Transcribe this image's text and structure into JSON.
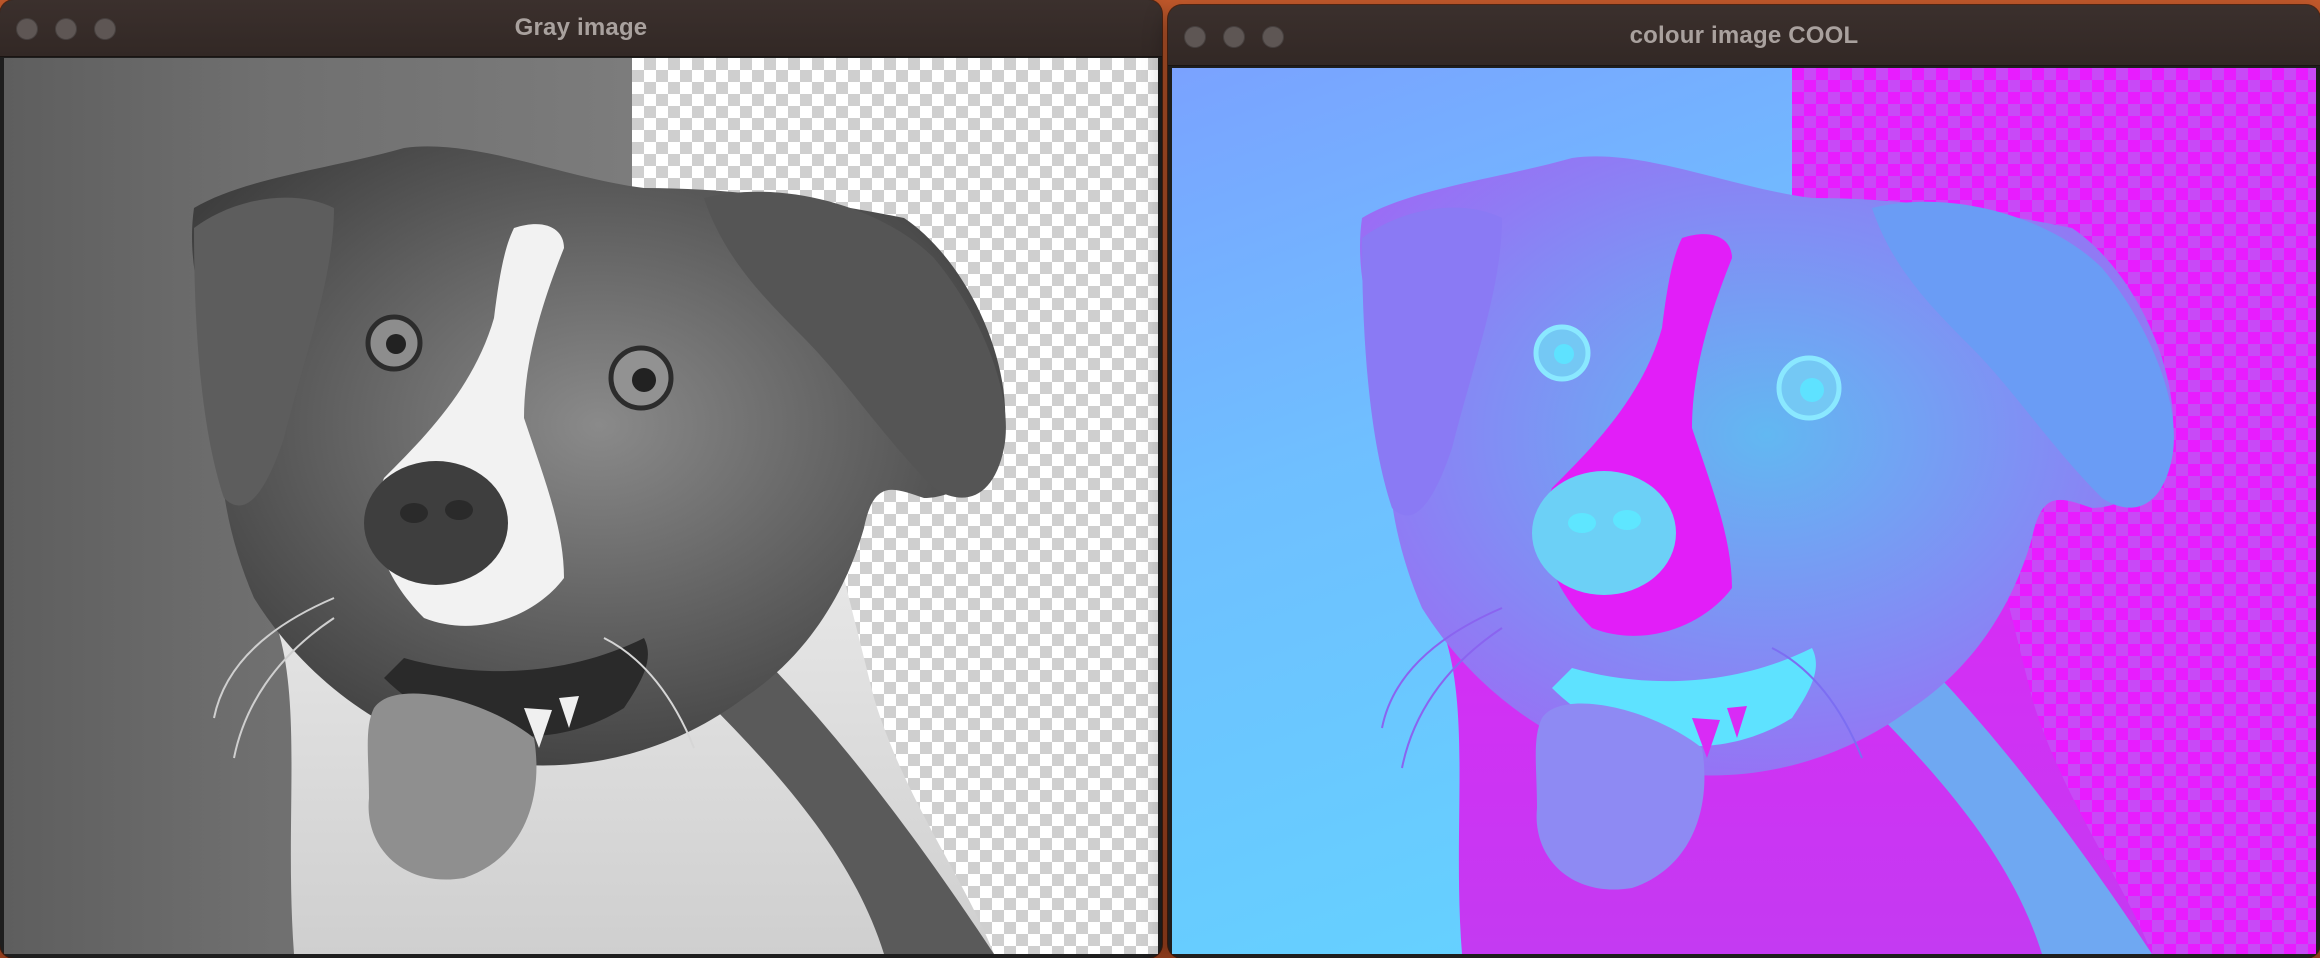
{
  "windows": {
    "gray": {
      "title": "Gray image"
    },
    "color": {
      "title": "colour image COOL"
    }
  },
  "colors": {
    "titlebar": "#3b302d",
    "traffic_light_inactive": "#5e5654",
    "gray_background": "#6f6f6f",
    "cool_light": "#63d4ff",
    "cool_magenta": "#e81cff"
  },
  "icons": {
    "close": "close-button-icon",
    "minimize": "minimize-button-icon",
    "zoom": "zoom-button-icon"
  }
}
